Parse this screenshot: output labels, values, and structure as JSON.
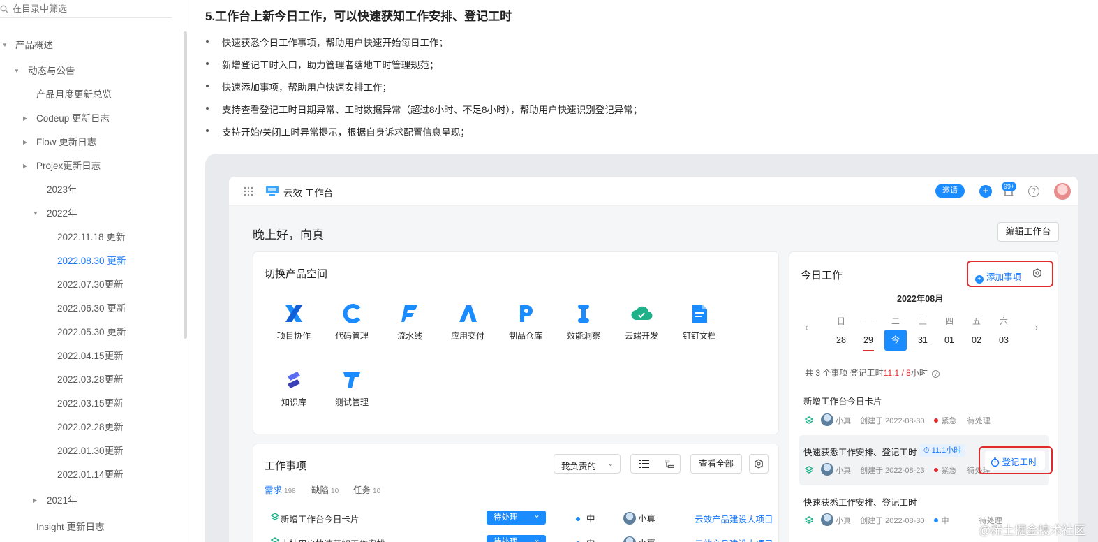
{
  "sidebar": {
    "filter_placeholder": "在目录中筛选",
    "items": [
      "产品概述",
      "动态与公告",
      "产品月度更新总览",
      "Codeup 更新日志",
      "Flow 更新日志",
      "Projex更新日志",
      "2023年",
      "2022年",
      "2022.11.18 更新",
      "2022.08.30 更新",
      "2022.07.30更新",
      "2022.06.30 更新",
      "2022.05.30 更新",
      "2022.04.15更新",
      "2022.03.28更新",
      "2022.03.15更新",
      "2022.02.28更新",
      "2022.01.30更新",
      "2022.01.14更新",
      "2021年",
      "Insight 更新日志"
    ]
  },
  "article": {
    "heading": "5.工作台上新今日工作，可以快速获知工作安排、登记工时",
    "bullets": [
      "快速获悉今日工作事项，帮助用户快速开始每日工作；",
      "新增登记工时入口，助力管理者落地工时管理规范；",
      "快速添加事项，帮助用户快速安排工作；",
      "支持查看登记工时日期异常、工时数据异常（超过8小时、不足8小时），帮助用户快速识别登记异常；",
      "支持开始/关闭工时异常提示，根据自身诉求配置信息呈现；"
    ]
  },
  "app": {
    "title": "云效 工作台",
    "invite": "邀请",
    "plus": "+",
    "badge": "99+",
    "help": "?",
    "greeting": "晚上好，向真",
    "edit_workbench": "编辑工作台",
    "products": {
      "title": "切换产品空间",
      "items": [
        "项目协作",
        "代码管理",
        "流水线",
        "应用交付",
        "制品仓库",
        "效能洞察",
        "云端开发",
        "钉钉文档",
        "知识库",
        "测试管理"
      ]
    },
    "work": {
      "title": "工作事项",
      "filter": "我负责的",
      "view_all": "查看全部",
      "tabs": [
        {
          "label": "需求",
          "count": "198"
        },
        {
          "label": "缺陷",
          "count": "10"
        },
        {
          "label": "任务",
          "count": "10"
        }
      ],
      "rows": [
        {
          "title": "新增工作台今日卡片",
          "status": "待处理",
          "priority": "中",
          "owner": "小真",
          "project": "云效产品建设大项目"
        },
        {
          "title": "支持用户快速获知工作安排",
          "status": "待处理",
          "priority": "中",
          "owner": "小真",
          "project": "云效产品建设大项目"
        }
      ]
    },
    "today": {
      "title": "今日工作",
      "add_item": "添加事项",
      "month": "2022年08月",
      "weekdays": [
        "日",
        "一",
        "二",
        "三",
        "四",
        "五",
        "六"
      ],
      "days": [
        "28",
        "29",
        "今",
        "31",
        "01",
        "02",
        "03"
      ],
      "summary_prefix": "共 3 个事项  登记工时",
      "logged": "11.1 / 8",
      "summary_suffix": "小时",
      "items": [
        {
          "title": "新增工作台今日卡片",
          "owner": "小真",
          "created": "创建于 2022-08-30",
          "priority": "紧急",
          "status": "待处理"
        },
        {
          "title": "快速获悉工作安排、登记工时",
          "owner": "小真",
          "created": "创建于 2022-08-23",
          "priority": "紧急",
          "status": "待处理",
          "hours": "11.1小时"
        },
        {
          "title": "快速获悉工作安排、登记工时",
          "owner": "小真",
          "created": "创建于 2022-08-30",
          "priority": "中",
          "status": "待处理"
        }
      ],
      "log_hours": "登记工时"
    }
  },
  "watermark": "@稀土掘金技术社区",
  "colors": {
    "accent": "#1a8cff",
    "link": "#1677ff",
    "alert": "#e02c2c"
  }
}
